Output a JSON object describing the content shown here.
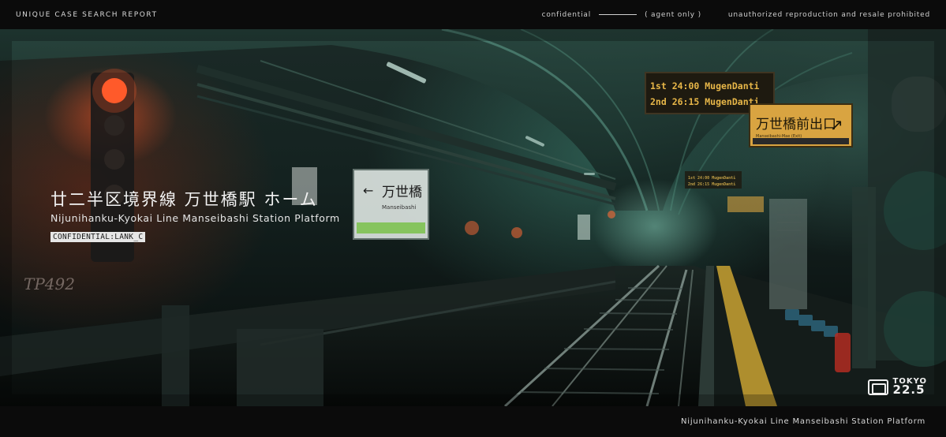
{
  "header": {
    "report_title": "UNIQUE CASE SEARCH REPORT",
    "confidential_label": "confidential",
    "agent_label": "( agent only )",
    "notice": "unauthorized reproduction and resale prohibited"
  },
  "scene": {
    "title_jp": "廿二半区境界線 万世橋駅 ホーム",
    "title_en": "Nijunihanku-Kyokai Line Manseibashi Station Platform",
    "badge": "CONFIDENTIAL:LANK_C",
    "departure_board": {
      "rows": [
        {
          "order": "1st",
          "time": "24:00",
          "dest": "MugenDanti"
        },
        {
          "order": "2nd",
          "time": "26:15",
          "dest": "MugenDanti"
        }
      ]
    },
    "exit_sign": {
      "jp": "万世橋前出口",
      "en": "Manseibashi-Mae (Exit)"
    },
    "station_sign": {
      "jp": "万世橋",
      "en": "Manseibashi"
    },
    "graffiti": "TP492"
  },
  "logo": {
    "line1": "TOKYO",
    "line2": "22.5"
  },
  "footer": {
    "caption": "Nijunihanku-Kyokai Line Manseibashi Station Platform"
  },
  "colors": {
    "signal_red": "#ff5a2a",
    "tunnel_green": "#3f8a78",
    "sign_amber": "#d9a441",
    "yellow_line": "#c9a233"
  }
}
